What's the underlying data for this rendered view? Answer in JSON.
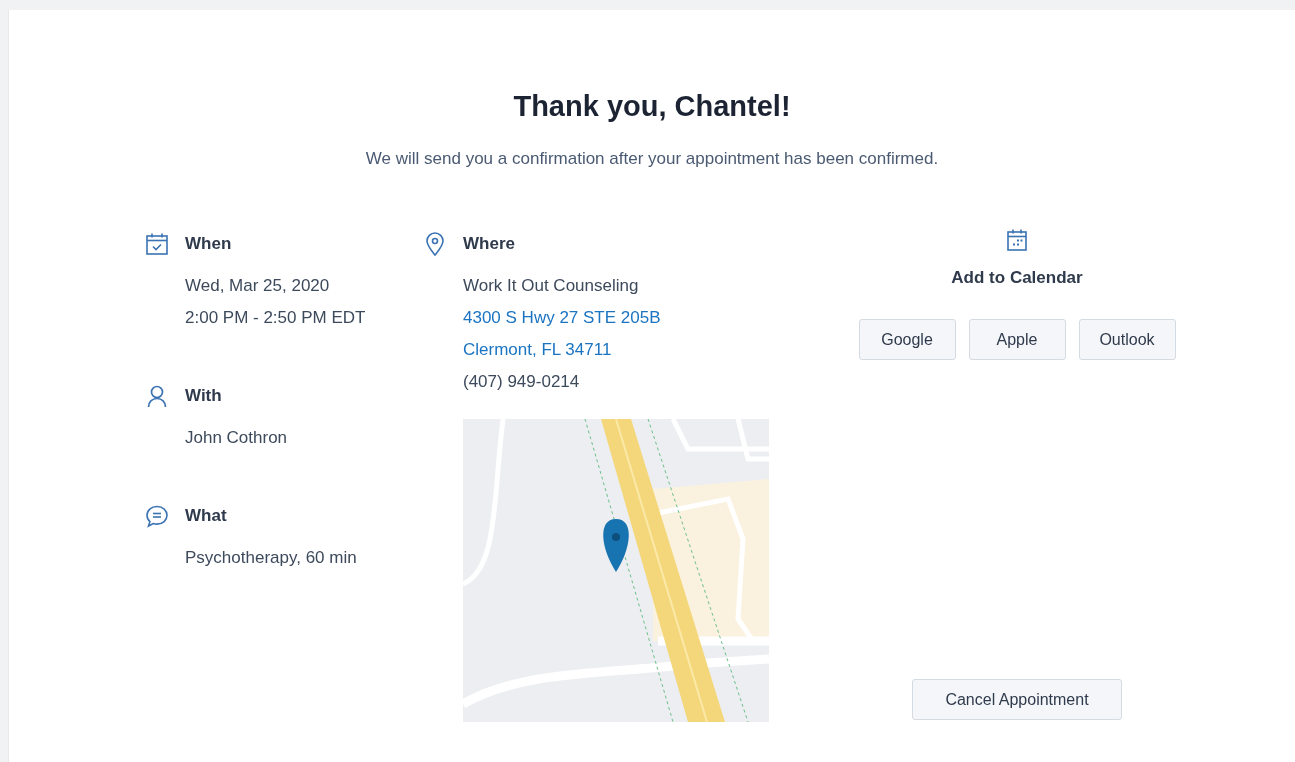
{
  "heading": "Thank you, Chantel!",
  "subheading": "We will send you a confirmation after your appointment has been confirmed.",
  "details": [
    {
      "kind": "when",
      "label": "When",
      "lines": [
        "Wed, Mar 25, 2020",
        "2:00 PM - 2:50 PM EDT"
      ]
    },
    {
      "kind": "with",
      "label": "With",
      "lines": [
        "John Cothron"
      ]
    },
    {
      "kind": "what",
      "label": "What",
      "lines": [
        "Psychotherapy, 60 min"
      ]
    }
  ],
  "location": {
    "label": "Where",
    "name": "Work It Out Counseling",
    "address_lines": [
      "4300 S Hwy 27 STE 205B",
      "Clermont, FL 34711"
    ],
    "phone": "(407) 949-0214",
    "map": {
      "kind": "picture"
    }
  },
  "calendar": {
    "label": "Add to Calendar",
    "buttons": [
      "Google",
      "Apple",
      "Outlook"
    ]
  },
  "cancel_button": "Cancel Appointment"
}
